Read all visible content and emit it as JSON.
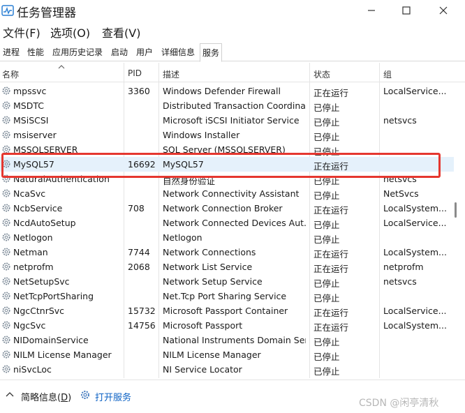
{
  "window": {
    "title": "任务管理器"
  },
  "menu": [
    "文件(F)",
    "选项(O)",
    "查看(V)"
  ],
  "tabs": [
    "进程",
    "性能",
    "应用历史记录",
    "启动",
    "用户",
    "详细信息",
    "服务"
  ],
  "active_tab": "服务",
  "columns": {
    "name": "名称",
    "pid": "PID",
    "desc": "描述",
    "status": "状态",
    "group": "组"
  },
  "rows": [
    {
      "name": "mpssvc",
      "pid": "3360",
      "desc": "Windows Defender Firewall",
      "status": "正在运行",
      "group": "LocalService..."
    },
    {
      "name": "MSDTC",
      "pid": "",
      "desc": "Distributed Transaction Coordina...",
      "status": "已停止",
      "group": ""
    },
    {
      "name": "MSiSCSI",
      "pid": "",
      "desc": "Microsoft iSCSI Initiator Service",
      "status": "已停止",
      "group": "netsvcs"
    },
    {
      "name": "msiserver",
      "pid": "",
      "desc": "Windows Installer",
      "status": "已停止",
      "group": ""
    },
    {
      "name": "MSSQLSERVER",
      "pid": "",
      "desc": "SQL Server (MSSQLSERVER)",
      "status": "已停止",
      "group": ""
    },
    {
      "name": "MySQL57",
      "pid": "16692",
      "desc": "MySQL57",
      "status": "正在运行",
      "group": ""
    },
    {
      "name": "NaturalAuthentication",
      "pid": "",
      "desc": "自然身份验证",
      "status": "已停止",
      "group": "netsvcs"
    },
    {
      "name": "NcaSvc",
      "pid": "",
      "desc": "Network Connectivity Assistant",
      "status": "已停止",
      "group": "NetSvcs"
    },
    {
      "name": "NcbService",
      "pid": "708",
      "desc": "Network Connection Broker",
      "status": "正在运行",
      "group": "LocalSystem..."
    },
    {
      "name": "NcdAutoSetup",
      "pid": "",
      "desc": "Network Connected Devices Aut...",
      "status": "已停止",
      "group": "LocalService..."
    },
    {
      "name": "Netlogon",
      "pid": "",
      "desc": "Netlogon",
      "status": "已停止",
      "group": ""
    },
    {
      "name": "Netman",
      "pid": "7744",
      "desc": "Network Connections",
      "status": "正在运行",
      "group": "LocalSystem..."
    },
    {
      "name": "netprofm",
      "pid": "2068",
      "desc": "Network List Service",
      "status": "正在运行",
      "group": "netprofm"
    },
    {
      "name": "NetSetupSvc",
      "pid": "",
      "desc": "Network Setup Service",
      "status": "已停止",
      "group": "netsvcs"
    },
    {
      "name": "NetTcpPortSharing",
      "pid": "",
      "desc": "Net.Tcp Port Sharing Service",
      "status": "已停止",
      "group": ""
    },
    {
      "name": "NgcCtnrSvc",
      "pid": "15732",
      "desc": "Microsoft Passport Container",
      "status": "正在运行",
      "group": "LocalService..."
    },
    {
      "name": "NgcSvc",
      "pid": "14756",
      "desc": "Microsoft Passport",
      "status": "正在运行",
      "group": "LocalSystem..."
    },
    {
      "name": "NIDomainService",
      "pid": "",
      "desc": "National Instruments Domain Ser...",
      "status": "已停止",
      "group": ""
    },
    {
      "name": "NILM License Manager",
      "pid": "",
      "desc": "NILM License Manager",
      "status": "已停止",
      "group": ""
    },
    {
      "name": "niSvcLoc",
      "pid": "",
      "desc": "NI Service Locator",
      "status": "已停止",
      "group": ""
    }
  ],
  "footer": {
    "fewer_details": "简略信息(",
    "fewer_key": "D",
    "fewer_close": ")",
    "open_services": "打开服务",
    "watermark": "CSDN @闲亭清秋"
  },
  "colors": {
    "highlight": "#e5372f",
    "link": "#0b61c4",
    "selected_row": "#e5f1fb"
  }
}
